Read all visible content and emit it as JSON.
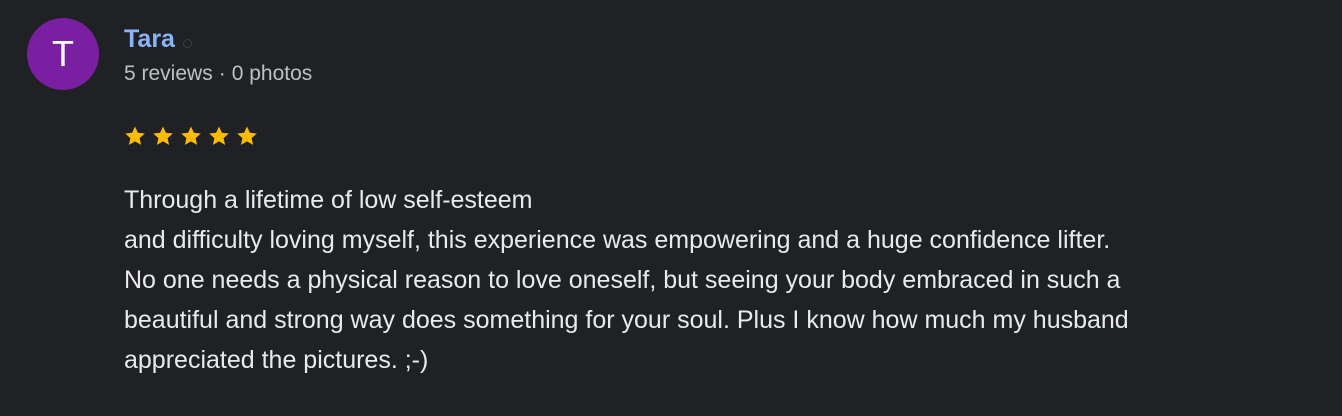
{
  "reviewer": {
    "initial": "T",
    "name": "Tara",
    "reviews": "5 reviews",
    "separator": "·",
    "photos": "0 photos",
    "avatar_color": "#7b1fa2",
    "name_color": "#8ab4f8"
  },
  "rating": {
    "value": 5,
    "max": 5,
    "star_color": "#fbbc04"
  },
  "review": {
    "lines": [
      "Through a lifetime of low self-esteem",
      "and difficulty loving myself, this experience was empowering and a huge confidence lifter.",
      "No one needs a physical reason to love oneself, but seeing your body embraced in such a",
      "beautiful and strong way does something for your soul. Plus I know how much my husband",
      "appreciated the pictures. ;-)"
    ]
  }
}
